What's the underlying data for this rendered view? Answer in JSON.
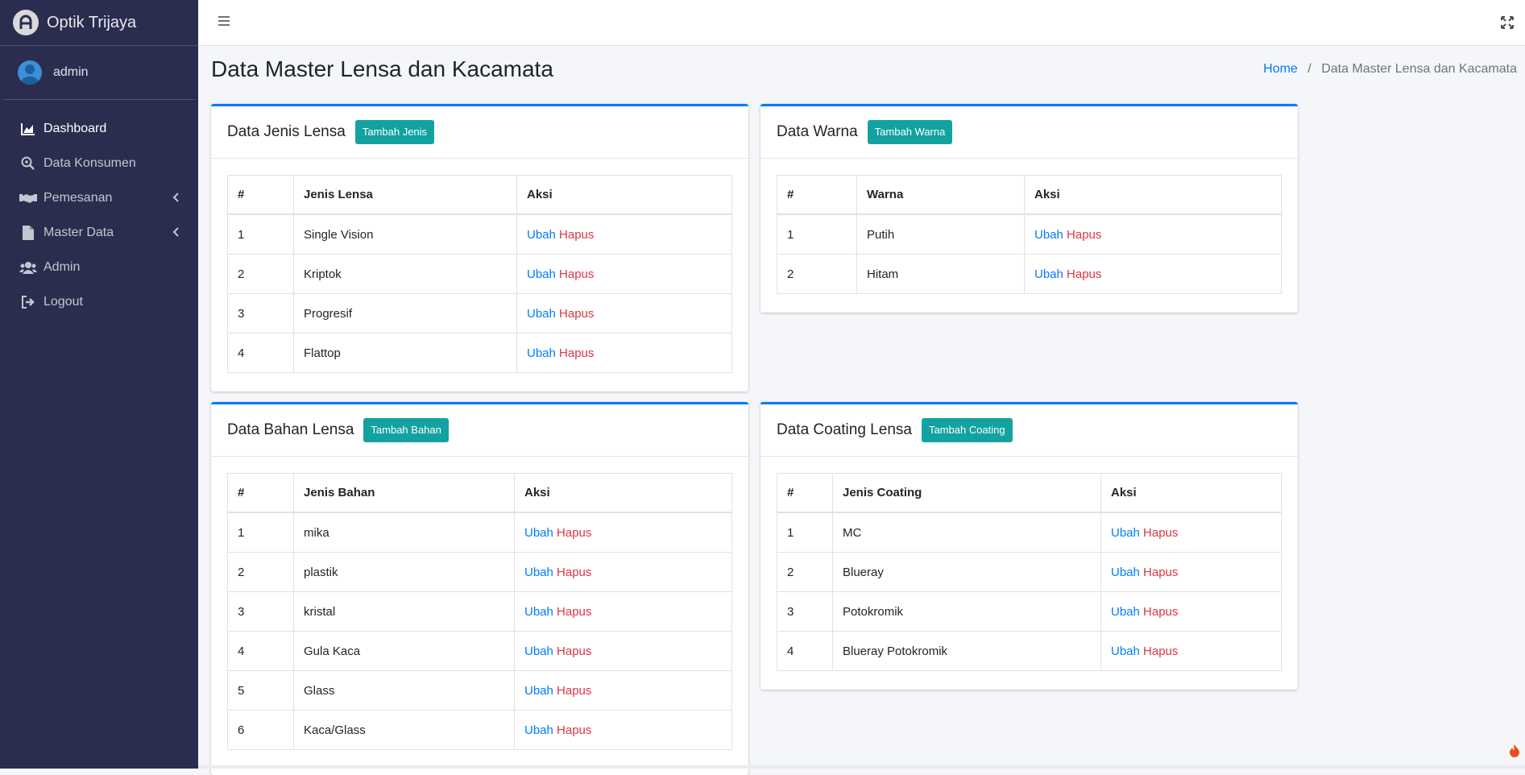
{
  "app": {
    "brand": "Optik Trijaya",
    "user": "admin"
  },
  "sidebar": {
    "items": [
      {
        "label": "Dashboard",
        "icon": "chart-area-icon"
      },
      {
        "label": "Data Konsumen",
        "icon": "search-icon"
      },
      {
        "label": "Pemesanan",
        "icon": "handshake-icon"
      },
      {
        "label": "Master Data",
        "icon": "file-icon"
      },
      {
        "label": "Admin",
        "icon": "users-icon"
      },
      {
        "label": "Logout",
        "icon": "sign-out-icon"
      }
    ]
  },
  "page": {
    "title": "Data Master Lensa dan Kacamata",
    "breadcrumb": {
      "home": "Home",
      "separator": "/",
      "current": "Data Master Lensa dan Kacamata"
    }
  },
  "actions": {
    "edit": "Ubah",
    "delete": "Hapus"
  },
  "cards": {
    "jenis": {
      "title": "Data Jenis Lensa",
      "button": "Tambah Jenis",
      "headers": [
        "#",
        "Jenis Lensa",
        "Aksi"
      ],
      "rows": [
        {
          "no": "1",
          "name": "Single Vision"
        },
        {
          "no": "2",
          "name": "Kriptok"
        },
        {
          "no": "3",
          "name": "Progresif"
        },
        {
          "no": "4",
          "name": "Flattop"
        }
      ]
    },
    "warna": {
      "title": "Data Warna",
      "button": "Tambah Warna",
      "headers": [
        "#",
        "Warna",
        "Aksi"
      ],
      "rows": [
        {
          "no": "1",
          "name": "Putih"
        },
        {
          "no": "2",
          "name": "Hitam"
        }
      ]
    },
    "bahan": {
      "title": "Data Bahan Lensa",
      "button": "Tambah Bahan",
      "headers": [
        "#",
        "Jenis Bahan",
        "Aksi"
      ],
      "rows": [
        {
          "no": "1",
          "name": "mika"
        },
        {
          "no": "2",
          "name": "plastik"
        },
        {
          "no": "3",
          "name": "kristal"
        },
        {
          "no": "4",
          "name": "Gula Kaca"
        },
        {
          "no": "5",
          "name": "Glass"
        },
        {
          "no": "6",
          "name": "Kaca/Glass"
        }
      ]
    },
    "coating": {
      "title": "Data Coating Lensa",
      "button": "Tambah Coating",
      "headers": [
        "#",
        "Jenis Coating",
        "Aksi"
      ],
      "rows": [
        {
          "no": "1",
          "name": "MC"
        },
        {
          "no": "2",
          "name": "Blueray"
        },
        {
          "no": "3",
          "name": "Potokromik"
        },
        {
          "no": "4",
          "name": "Blueray Potokromik"
        }
      ]
    }
  },
  "colors": {
    "sidebar": "#2b2d4f",
    "accent": "#007bff",
    "button": "#13a2a0",
    "danger": "#dc3545"
  }
}
